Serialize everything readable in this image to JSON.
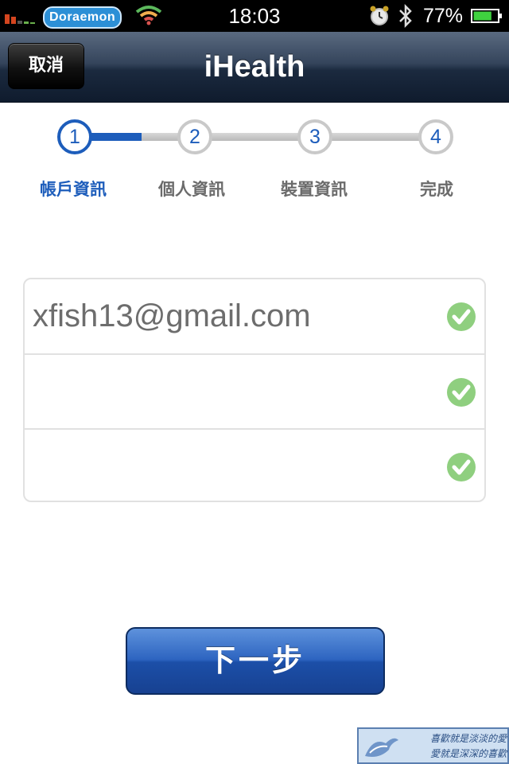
{
  "status_bar": {
    "carrier": "Doraemon",
    "time": "18:03",
    "battery_percent": "77%",
    "battery_level": 0.77,
    "icons": [
      "signal-icon",
      "wifi-icon",
      "alarm-clock-icon",
      "bluetooth-icon",
      "battery-icon"
    ]
  },
  "nav_bar": {
    "cancel_label": "取消",
    "title": "iHealth"
  },
  "stepper": {
    "current_step": 1,
    "steps": [
      {
        "number": "1",
        "label": "帳戶資訊"
      },
      {
        "number": "2",
        "label": "個人資訊"
      },
      {
        "number": "3",
        "label": "裝置資訊"
      },
      {
        "number": "4",
        "label": "完成"
      }
    ]
  },
  "form": {
    "fields": [
      {
        "value": "xfish13@gmail.com",
        "validated": true
      },
      {
        "value": "",
        "validated": true
      },
      {
        "value": "",
        "validated": true
      }
    ]
  },
  "next_button": {
    "label": "下一步"
  },
  "watermark": {
    "line1": "喜歡就是淡淡的愛",
    "line2": "愛就是深深的喜歡"
  },
  "colors": {
    "accent": "#1d5dbb",
    "check": "#8fcf7f",
    "nav_dark": "#0f1b2d"
  }
}
